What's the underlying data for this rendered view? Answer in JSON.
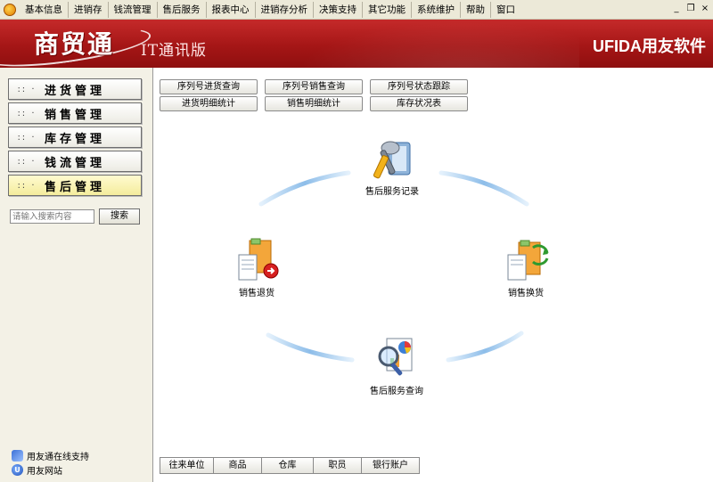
{
  "menu": {
    "items": [
      "基本信息",
      "进销存",
      "钱流管理",
      "售后服务",
      "报表中心",
      "进销存分析",
      "决策支持",
      "其它功能",
      "系统维护",
      "帮助",
      "窗口"
    ],
    "window_controls": [
      "_",
      "❐",
      "×"
    ]
  },
  "banner": {
    "brand": "商贸通",
    "edition": "IT通讯版",
    "vendor": "UFIDA用友软件"
  },
  "sidebar": {
    "nav": [
      {
        "dots": ":: ·",
        "label": "进货管理",
        "active": false
      },
      {
        "dots": ":: ·",
        "label": "销售管理",
        "active": false
      },
      {
        "dots": ":: ·",
        "label": "库存管理",
        "active": false
      },
      {
        "dots": ":: ·",
        "label": "钱流管理",
        "active": false
      },
      {
        "dots": ":: ·",
        "label": "售后管理",
        "active": true
      }
    ],
    "search": {
      "placeholder": "请输入搜索内容",
      "button": "搜索"
    },
    "links": {
      "support": "用友通在线支持",
      "site": "用友网站"
    },
    "site_icon": "U"
  },
  "main": {
    "top_buttons": [
      "序列号进货查询",
      "序列号销售查询",
      "序列号状态跟踪",
      "进货明细统计",
      "销售明细统计",
      "库存状况表"
    ],
    "flow": {
      "service_record": "售后服务记录",
      "sales_return": "销售退货",
      "sales_exchange": "销售换货",
      "service_query": "售后服务查询"
    },
    "bottom_tabs": [
      "往来单位",
      "商品",
      "仓库",
      "职员",
      "银行账户"
    ]
  },
  "colors": {
    "banner_red": "#a51616",
    "active_nav": "#f4ec9c",
    "arc_blue": "#9cc6ee"
  }
}
